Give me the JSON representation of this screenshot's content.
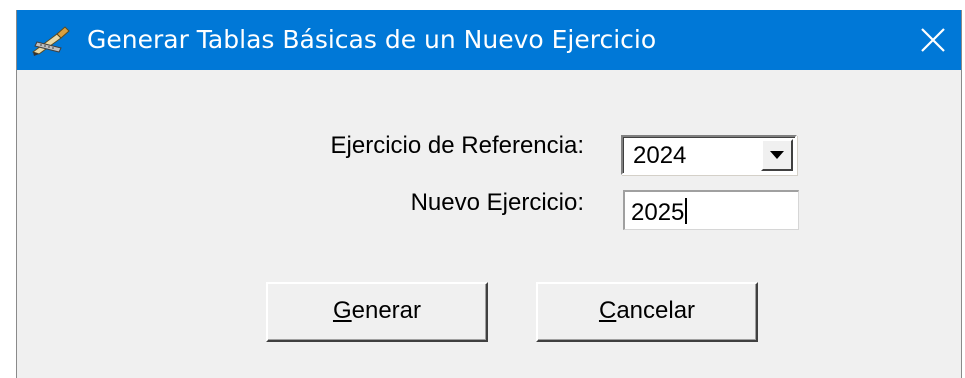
{
  "window": {
    "title": "Generar Tablas Básicas de un Nuevo Ejercicio",
    "icon": "pencil-ruler-icon",
    "close_glyph": "close-icon"
  },
  "form": {
    "reference_label": "Ejercicio de Referencia:",
    "reference_value": "2024",
    "new_label": "Nuevo Ejercicio:",
    "new_value": "2025"
  },
  "buttons": {
    "generar_mnemonic": "G",
    "generar_rest": "enerar",
    "cancelar_mnemonic": "C",
    "cancelar_rest": "ancelar"
  },
  "colors": {
    "titlebar": "#0078d7",
    "face": "#f0f0f0"
  }
}
